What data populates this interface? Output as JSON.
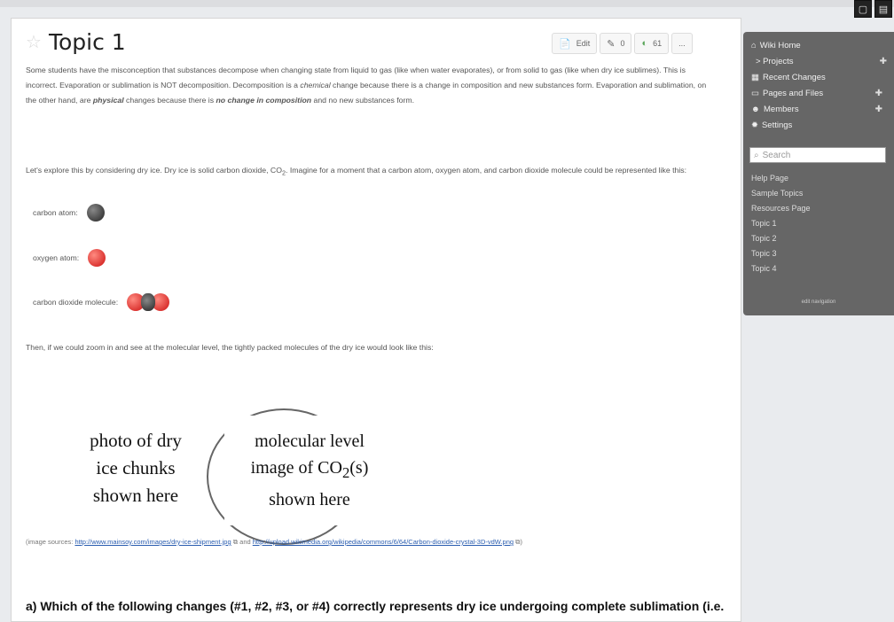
{
  "page": {
    "title": "Topic 1",
    "actions": {
      "edit": "Edit",
      "comments": "0",
      "views": "61",
      "more": "..."
    },
    "para1_a": "Some students have the misconception that substances decompose when changing state from liquid to gas (like when water evaporates), or from solid to gas (like when dry ice sublimes). This is incorrect. Evaporation or sublimation is NOT decomposition. Decomposition is a ",
    "para1_chem": "chemical",
    "para1_b": " change because there is a change in composition and new substances form. Evaporation and sublimation, on the other hand, are ",
    "para1_phys": "physical",
    "para1_c": " changes because there is ",
    "para1_nochange": "no change in composition",
    "para1_d": " and no new substances form.",
    "para2_a": "Let's explore this by considering dry ice. Dry ice is solid carbon dioxide, CO",
    "para2_sub": "2",
    "para2_b": ". Imagine for a moment that a carbon atom, oxygen atom, and carbon dioxide molecule could be represented like this:",
    "carbon_label": "carbon atom:",
    "oxygen_label": "oxygen atom:",
    "co2_label": "carbon dioxide molecule:",
    "para3": "Then, if we could zoom in and see at the molecular level, the tightly packed molecules of the dry ice would look like this:",
    "photo_placeholder_1": "photo of dry",
    "photo_placeholder_2": "ice chunks",
    "photo_placeholder_3": "shown here",
    "mol_placeholder_1": "molecular level",
    "mol_placeholder_2a": "image of CO",
    "mol_placeholder_2sub": "2",
    "mol_placeholder_2b": "(s)",
    "mol_placeholder_3": "shown here",
    "sources_prefix": "(image sources: ",
    "source_link_1": "http://www.mainsoy.com/images/dry-ice-shipment.jpg",
    "sources_and": " and ",
    "source_link_2": "http://upload.wikimedia.org/wikipedia/commons/6/64/Carbon-dioxide-crystal-3D-vdW.png",
    "sources_suffix": ")",
    "question": "a) Which of the following changes (#1, #2, #3, or #4) correctly represents dry ice undergoing complete sublimation (i.e. changing from all solid to all gas)? Briefly explain your choice."
  },
  "sidebar": {
    "wiki_home": "Wiki Home",
    "projects": "> Projects",
    "recent_changes": "Recent Changes",
    "pages_files": "Pages and Files",
    "members": "Members",
    "settings": "Settings",
    "search_placeholder": "Search",
    "links": [
      "Help Page",
      "Sample Topics",
      "Resources Page",
      "Topic 1",
      "Topic 2",
      "Topic 3",
      "Topic 4"
    ],
    "edit_navigation": "edit navigation"
  },
  "colors": {
    "sidebar_bg": "#666666",
    "link": "#2a5db0"
  }
}
